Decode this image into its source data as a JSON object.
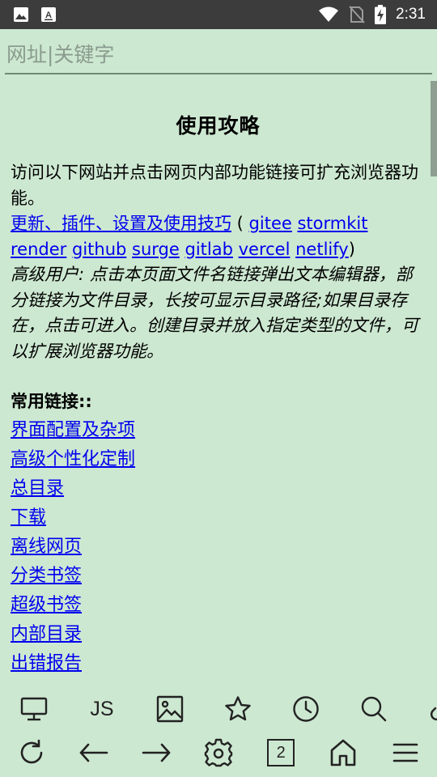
{
  "status_bar": {
    "time": "2:31",
    "icons": [
      "image-icon",
      "text-icon",
      "wifi-icon",
      "no-sim-icon",
      "battery-charging-icon"
    ]
  },
  "url_bar": {
    "placeholder": "网址|关键字",
    "value": ""
  },
  "page": {
    "title": "使用攻略",
    "intro": "访问以下网站并点击网页内部功能链接可扩充浏览器功能。",
    "main_link": "更新、插件、设置及使用技巧",
    "paren_open": " ( ",
    "mirror_links": [
      "gitee",
      "stormkit",
      "render",
      "github",
      "surge",
      "gitlab",
      "vercel",
      "netlify"
    ],
    "paren_close": ")",
    "advanced_note": "高级用户: 点击本页面文件名链接弹出文本编辑器，部分链接为文件目录，长按可显示目录路径;如果目录存在，点击可进入。创建目录并放入指定类型的文件，可以扩展浏览器功能。",
    "common_links_title": "常用链接::",
    "common_links": [
      "界面配置及杂项",
      "高级个性化定制",
      "总目录",
      "下载",
      "离线网页",
      "分类书签",
      "超级书签",
      "内部目录",
      "出错报告"
    ]
  },
  "toolbar_top": {
    "items": [
      "desktop-icon",
      "js",
      "image-icon",
      "star-icon",
      "history-icon",
      "search-icon",
      "link-icon"
    ],
    "js_label": "JS"
  },
  "toolbar_bottom": {
    "items": [
      "reload-icon",
      "back-icon",
      "forward-icon",
      "settings-icon",
      "tabs",
      "home-icon",
      "menu-icon"
    ],
    "tab_count": "2"
  },
  "colors": {
    "background": "#cde8d1",
    "status_bar": "#3c3c3c",
    "link": "#0000ee"
  }
}
